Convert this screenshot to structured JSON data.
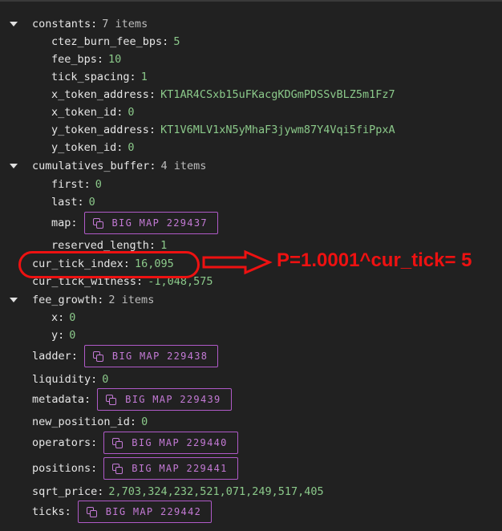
{
  "tree": {
    "constants": {
      "key": "constants",
      "meta": "7 items",
      "children": [
        {
          "key": "ctez_burn_fee_bps",
          "value": "5"
        },
        {
          "key": "fee_bps",
          "value": "10"
        },
        {
          "key": "tick_spacing",
          "value": "1"
        },
        {
          "key": "x_token_address",
          "value": "KT1AR4CSxb15uFKacgKDGmPDSSvBLZ5m1Fz7"
        },
        {
          "key": "x_token_id",
          "value": "0"
        },
        {
          "key": "y_token_address",
          "value": "KT1V6MLV1xN5yMhaF3jywm87Y4Vqi5fiPpxA"
        },
        {
          "key": "y_token_id",
          "value": "0"
        }
      ]
    },
    "cumulatives_buffer": {
      "key": "cumulatives_buffer",
      "meta": "4 items",
      "first": {
        "key": "first",
        "value": "0"
      },
      "last": {
        "key": "last",
        "value": "0"
      },
      "map": {
        "key": "map",
        "value": "BIG MAP 229437"
      },
      "reserved_length": {
        "key": "reserved_length",
        "value": "1"
      }
    },
    "cur_tick_index": {
      "key": "cur_tick_index",
      "value": "16,095"
    },
    "cur_tick_witness": {
      "key": "cur_tick_witness",
      "value": "-1,048,575"
    },
    "fee_growth": {
      "key": "fee_growth",
      "meta": "2 items",
      "x": {
        "key": "x",
        "value": "0"
      },
      "y": {
        "key": "y",
        "value": "0"
      }
    },
    "ladder": {
      "key": "ladder",
      "value": "BIG MAP 229438"
    },
    "liquidity": {
      "key": "liquidity",
      "value": "0"
    },
    "metadata": {
      "key": "metadata",
      "value": "BIG MAP 229439"
    },
    "new_position_id": {
      "key": "new_position_id",
      "value": "0"
    },
    "operators": {
      "key": "operators",
      "value": "BIG MAP 229440"
    },
    "positions": {
      "key": "positions",
      "value": "BIG MAP 229441"
    },
    "sqrt_price": {
      "key": "sqrt_price",
      "value": "2,703,324,232,521,071,249,517,405"
    },
    "ticks": {
      "key": "ticks",
      "value": "BIG MAP 229442"
    }
  },
  "annotation": {
    "formula": "P=1.0001^cur_tick= 5",
    "color": "#ee1111"
  },
  "colors": {
    "background": "#212121",
    "value_green": "#8bc98a",
    "bigmap_purple": "#c47ad6"
  },
  "icons": [
    "caret-down-icon",
    "copy-icon"
  ]
}
